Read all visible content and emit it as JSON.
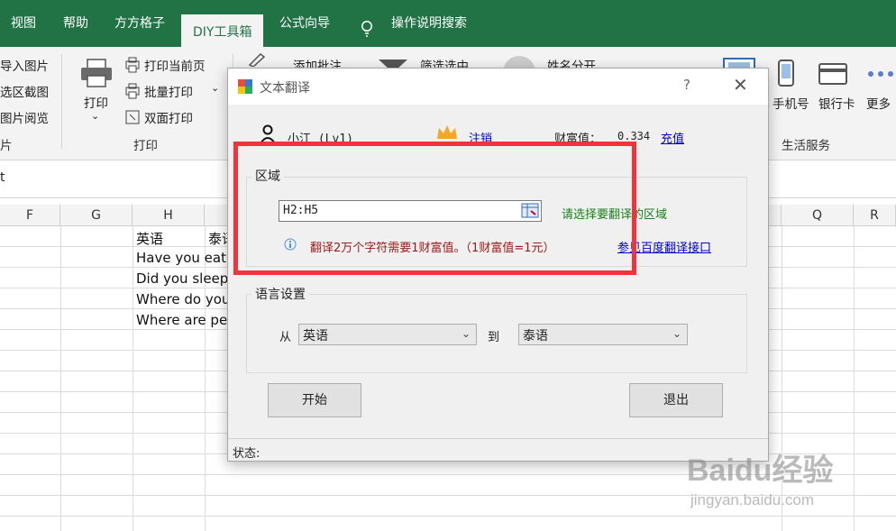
{
  "ribbon_tabs": [
    "视图",
    "帮助",
    "方方格子",
    "DIY工具箱",
    "公式向导",
    "操作说明搜索"
  ],
  "ribbon": {
    "left_items": [
      "导入图片",
      "选区截图",
      "图片阅览"
    ],
    "left_group": "片",
    "print_button": "打印",
    "print_items": [
      "打印当前页",
      "批量打印",
      "双面打印"
    ],
    "print_group": "打印",
    "comment_item": "添加批注",
    "filter_item": "筛选选中",
    "name_item": "姓名分开",
    "right_buttons": [
      "手机号",
      "银行卡",
      "更多"
    ],
    "right_group": "生活服务"
  },
  "formula_bar_text": "t",
  "columns": [
    "F",
    "G",
    "H",
    "Q",
    "R"
  ],
  "cells": {
    "h1": "英语",
    "i1": "泰语",
    "h2": "Have you eaten",
    "h3": "Did you sleep",
    "h4": "Where do you",
    "h5": "Where are pe"
  },
  "dialog": {
    "title": "文本翻译",
    "help": "?",
    "close": "✕",
    "user": "小江 (Lv1)",
    "logout": "注销",
    "wealth_label": "财富值：",
    "wealth_value": "0.334",
    "recharge": "充值",
    "region_legend": "区域",
    "region_value": "H2:H5",
    "region_hint": "请选择要翻译的区域",
    "cost_note": "翻译2万个字符需要1财富值。（1财富值=1元）",
    "api_link": "参见百度翻译接口",
    "lang_legend": "语言设置",
    "from_label": "从",
    "from_value": "英语",
    "to_label": "到",
    "to_value": "泰语",
    "start": "开始",
    "exit": "退出",
    "status": "状态:"
  },
  "watermark": {
    "brand": "Baidu经验",
    "url": "jingyan.baidu.com"
  }
}
